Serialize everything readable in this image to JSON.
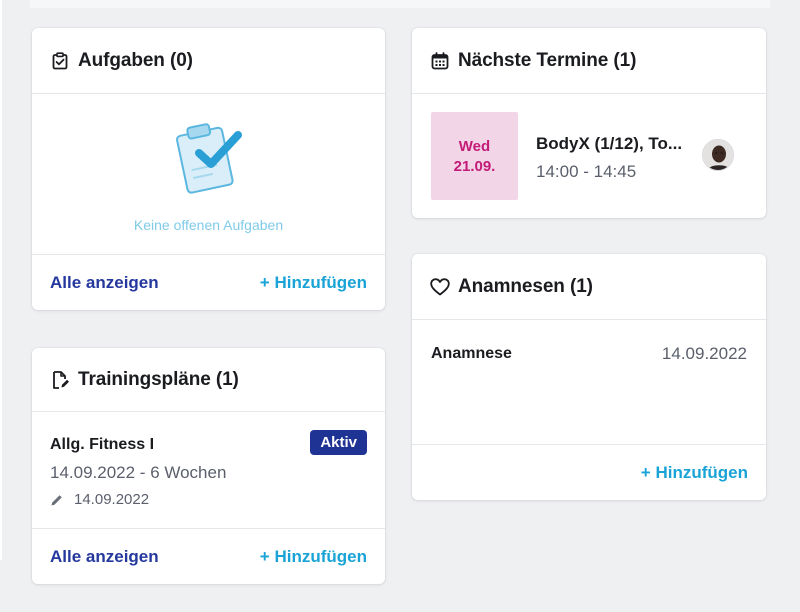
{
  "tasks": {
    "title": "Aufgaben (0)",
    "icon": "clipboard-check-icon",
    "empty_text": "Keine offenen Aufgaben",
    "show_all": "Alle anzeigen",
    "add": "+ Hinzufügen"
  },
  "plans": {
    "title": "Trainingspläne (1)",
    "icon": "document-edit-icon",
    "item": {
      "name": "Allg. Fitness I",
      "status": "Aktiv",
      "range": "14.09.2022 - 6 Wochen",
      "edited": "14.09.2022"
    },
    "show_all": "Alle anzeigen",
    "add": "+ Hinzufügen"
  },
  "appointments": {
    "title": "Nächste Termine (1)",
    "icon": "calendar-icon",
    "item": {
      "day": "Wed",
      "date": "21.09.",
      "title": "BodyX (1/12), To...",
      "time": "14:00 - 14:45"
    }
  },
  "anamnesis": {
    "title": "Anamnesen (1)",
    "icon": "heart-icon",
    "item": {
      "name": "Anamnese",
      "date": "14.09.2022"
    },
    "add": "+ Hinzufügen"
  },
  "colors": {
    "link_primary": "#25389e",
    "link_add": "#1aa3d6",
    "badge_bg": "#1f3394",
    "date_bg": "#f2d6e8",
    "date_text": "#c41a78"
  }
}
